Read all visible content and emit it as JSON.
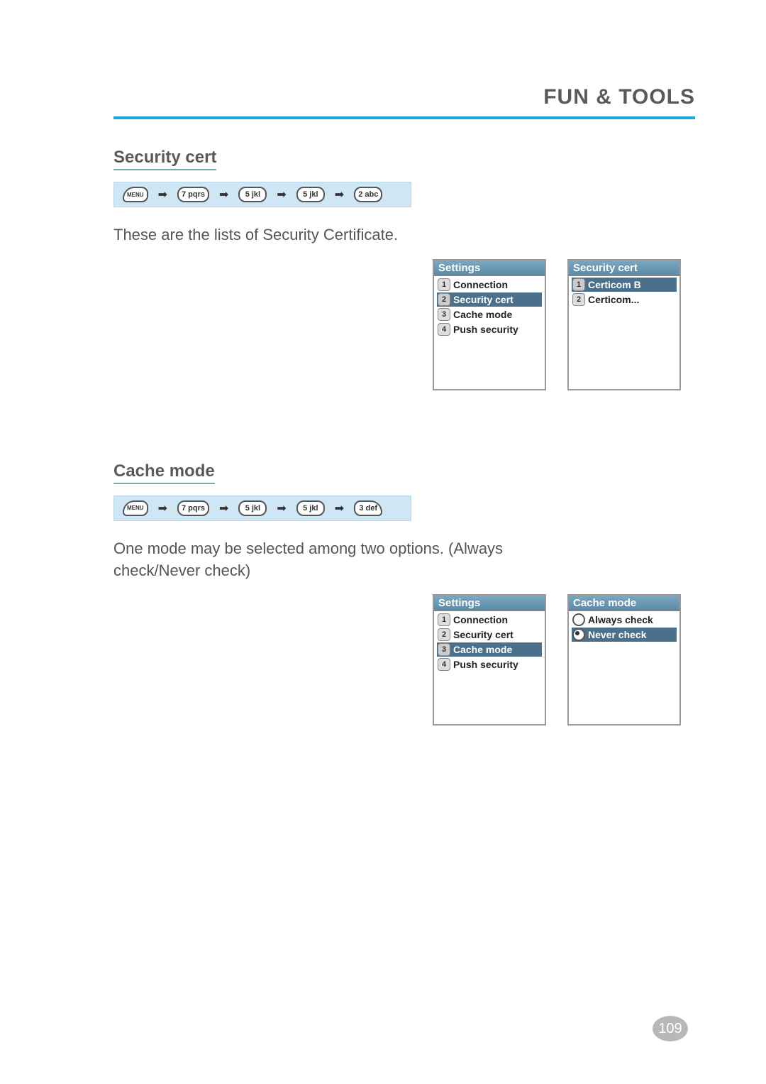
{
  "header": {
    "title": "FUN & TOOLS"
  },
  "section1": {
    "title": "Security cert",
    "keys": [
      "MENU",
      "7 pqrs",
      "5 jkl",
      "5 jkl",
      "2 abc"
    ],
    "body": "These are the lists of Security Certificate.",
    "screens": [
      {
        "title": "Settings",
        "items": [
          {
            "n": "1",
            "label": "Connection",
            "selected": false
          },
          {
            "n": "2",
            "label": "Security cert",
            "selected": true
          },
          {
            "n": "3",
            "label": "Cache mode",
            "selected": false
          },
          {
            "n": "4",
            "label": "Push security",
            "selected": false
          }
        ]
      },
      {
        "title": "Security cert",
        "items": [
          {
            "n": "1",
            "label": "Certicom B",
            "selected": true
          },
          {
            "n": "2",
            "label": "Certicom...",
            "selected": false
          }
        ]
      }
    ]
  },
  "section2": {
    "title": "Cache mode",
    "keys": [
      "MENU",
      "7 pqrs",
      "5 jkl",
      "5 jkl",
      "3 def"
    ],
    "body": "One mode may be selected among two options. (Always check/Never check)",
    "screens": [
      {
        "title": "Settings",
        "items": [
          {
            "n": "1",
            "label": "Connection",
            "selected": false
          },
          {
            "n": "2",
            "label": "Security cert",
            "selected": false
          },
          {
            "n": "3",
            "label": "Cache mode",
            "selected": true
          },
          {
            "n": "4",
            "label": "Push security",
            "selected": false
          }
        ]
      },
      {
        "title": "Cache mode",
        "radios": [
          {
            "label": "Always check",
            "selected": false
          },
          {
            "label": "Never check",
            "selected": true
          }
        ]
      }
    ]
  },
  "pageNumber": "109"
}
